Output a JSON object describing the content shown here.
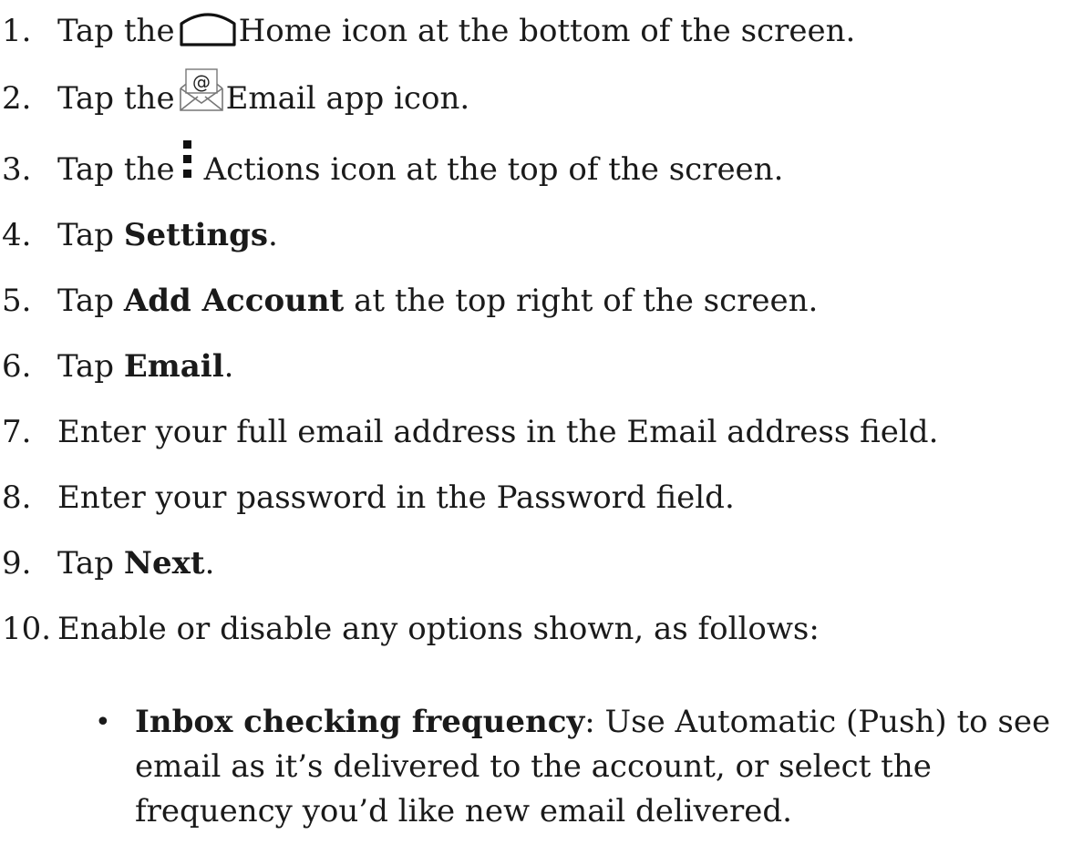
{
  "steps": [
    {
      "num": "1.",
      "pre": "Tap the",
      "icon": "home-icon",
      "post": "Home icon at the bottom of the screen."
    },
    {
      "num": "2.",
      "pre": "Tap the",
      "icon": "email-app-icon",
      "post": "Email app icon."
    },
    {
      "num": "3.",
      "pre": "Tap the",
      "icon": "actions-icon",
      "post": "Actions icon at the top of the screen."
    },
    {
      "num": "4.",
      "pre": "Tap ",
      "bold": "Settings",
      "post": "."
    },
    {
      "num": "5.",
      "pre": "Tap ",
      "bold": "Add Account",
      "post": " at the top right of the screen."
    },
    {
      "num": "6.",
      "pre": "Tap ",
      "bold": "Email",
      "post": "."
    },
    {
      "num": "7.",
      "text": "Enter your full email address in the Email address field."
    },
    {
      "num": "8.",
      "text": "Enter your password in the Password field."
    },
    {
      "num": "9.",
      "pre": "Tap ",
      "bold": "Next",
      "post": "."
    },
    {
      "num": "10.",
      "text": "Enable or disable any options shown, as follows:"
    }
  ],
  "sub_items": [
    {
      "bullet": "•",
      "bold": "Inbox checking frequency",
      "text": ": Use Automatic (Push) to see email as it’s delivered to the account, or select the frequency you’d like new email delivered."
    }
  ]
}
